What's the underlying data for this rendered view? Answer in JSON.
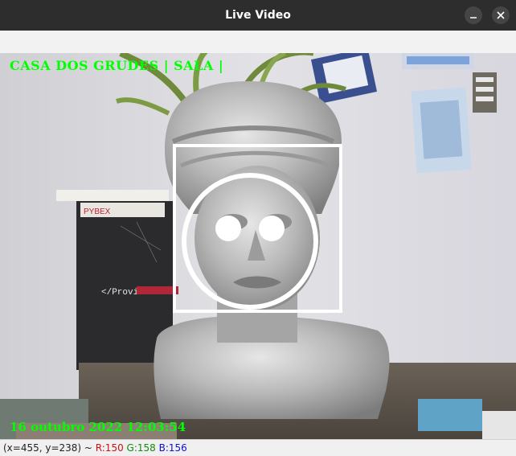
{
  "window": {
    "title": "Live Video",
    "minimize_icon": "minimize-icon",
    "close_icon": "close-icon"
  },
  "video": {
    "overlay_top": "CASA DOS GRUDES | SALA |",
    "overlay_bottom": "16 outubro 2022 12:03:54",
    "overlay_color": "#00ff00",
    "annotation_color": "#ffffff"
  },
  "status": {
    "coords": "(x=455, y=238) ~ ",
    "r": "R:150",
    "g": "G:158",
    "b": "B:156"
  },
  "notebook": {
    "label": "</Provi"
  }
}
